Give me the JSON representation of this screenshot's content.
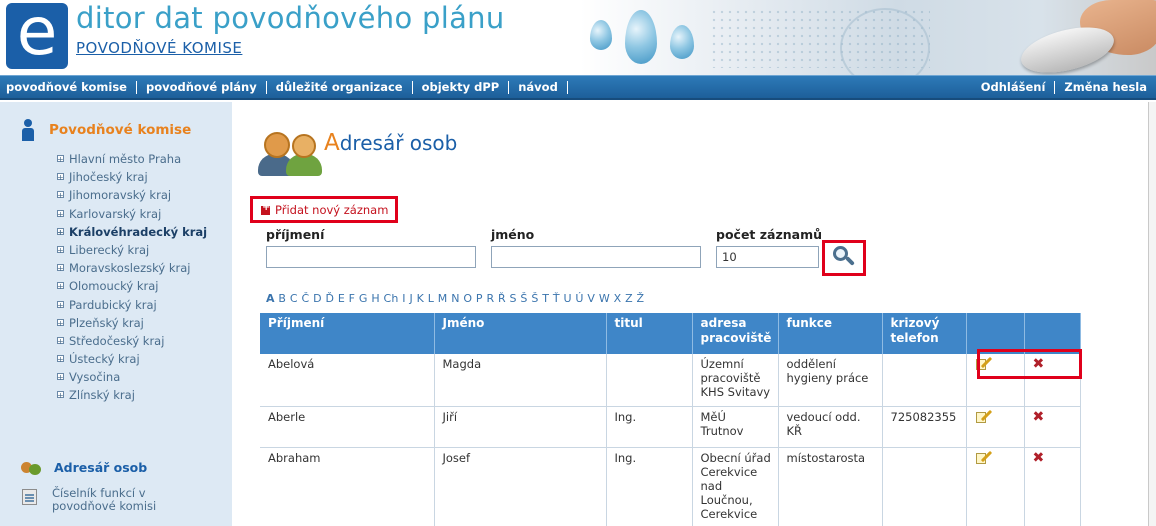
{
  "header": {
    "logo_letter": "e",
    "title": "ditor dat povodňového plánu",
    "subtitle": "POVODŇOVÉ KOMISE"
  },
  "nav": {
    "left": [
      "povodňové komise",
      "povodňové plány",
      "důležité organizace",
      "objekty dPP",
      "návod"
    ],
    "right": [
      "Odhlášení",
      "Změna hesla"
    ]
  },
  "sidebar": {
    "title": "Povodňové komise",
    "items": [
      {
        "label": "Hlavní město Praha",
        "active": false
      },
      {
        "label": "Jihočeský kraj",
        "active": false
      },
      {
        "label": "Jihomoravský kraj",
        "active": false
      },
      {
        "label": "Karlovarský kraj",
        "active": false
      },
      {
        "label": "Královéhradecký kraj",
        "active": true
      },
      {
        "label": "Liberecký kraj",
        "active": false
      },
      {
        "label": "Moravskoslezský kraj",
        "active": false
      },
      {
        "label": "Olomoucký kraj",
        "active": false
      },
      {
        "label": "Pardubický kraj",
        "active": false
      },
      {
        "label": "Plzeňský kraj",
        "active": false
      },
      {
        "label": "Středočeský kraj",
        "active": false
      },
      {
        "label": "Ústecký kraj",
        "active": false
      },
      {
        "label": "Vysočina",
        "active": false
      },
      {
        "label": "Zlínský kraj",
        "active": false
      }
    ],
    "adresar": "Adresář osob",
    "ciselnik": "Číselník funkcí v povodňové komisi"
  },
  "main": {
    "title_first": "A",
    "title_rest": "dresář osob",
    "add_label": "Přidat nový záznam",
    "filters": {
      "prijmeni_label": "příjmení",
      "prijmeni_value": "",
      "jmeno_label": "jméno",
      "jmeno_value": "",
      "pocet_label": "počet záznamů",
      "pocet_value": "10"
    },
    "alphabet": [
      "A",
      "B",
      "C",
      "Č",
      "D",
      "Ď",
      "E",
      "F",
      "G",
      "H",
      "Ch",
      "I",
      "J",
      "K",
      "L",
      "M",
      "N",
      "O",
      "P",
      "R",
      "Ř",
      "S",
      "Š",
      "Š",
      "T",
      "Ť",
      "U",
      "Ú",
      "V",
      "W",
      "X",
      "Z",
      "Ž"
    ],
    "table": {
      "columns": [
        "Příjmení",
        "Jméno",
        "titul",
        "adresa pracoviště",
        "funkce",
        "krizový telefon",
        "",
        ""
      ],
      "rows": [
        {
          "prijmeni": "Abelová",
          "jmeno": "Magda",
          "titul": "",
          "adresa": "Územní pracoviště KHS Svitavy",
          "funkce": "oddělení hygieny práce",
          "telefon": ""
        },
        {
          "prijmeni": "Aberle",
          "jmeno": "Jiří",
          "titul": "Ing.",
          "adresa": "MěÚ Trutnov",
          "funkce": "vedoucí odd. KŘ",
          "telefon": "725082355"
        },
        {
          "prijmeni": "Abraham",
          "jmeno": "Josef",
          "titul": "Ing.",
          "adresa": "Obecní úřad Cerekvice nad Loučnou, Cerekvice",
          "funkce": "místostarosta",
          "telefon": ""
        }
      ]
    }
  },
  "colors": {
    "nav_bg": "#2d7ab8",
    "table_header": "#3f86c8",
    "sidebar_bg": "#dde9f4",
    "accent_orange": "#e8821e",
    "highlight_red": "#e0001b"
  },
  "icons": {
    "edit": "edit-pencil-icon",
    "delete": "delete-x-icon",
    "search": "search-magnifier-icon"
  }
}
